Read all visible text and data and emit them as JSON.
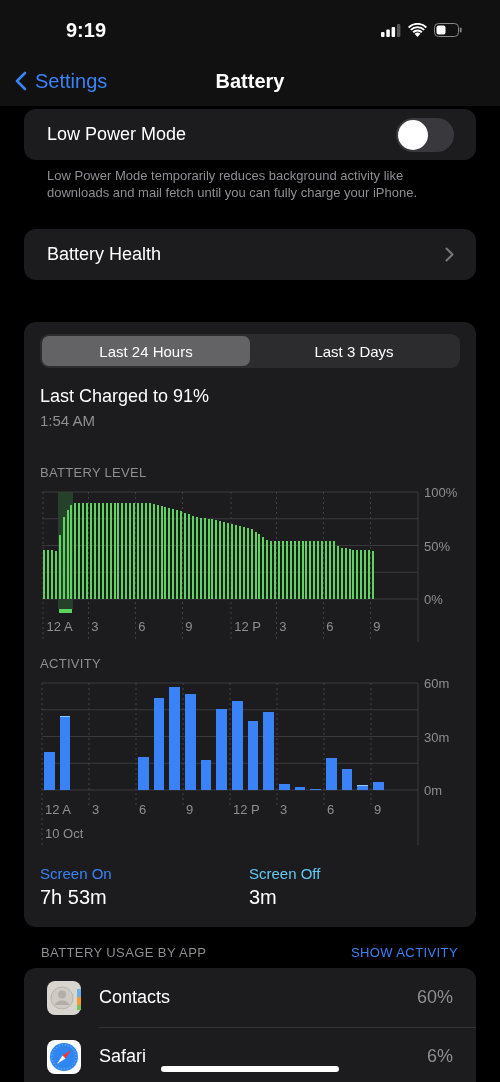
{
  "status_bar": {
    "time": "9:19"
  },
  "nav": {
    "back": "Settings",
    "title": "Battery"
  },
  "low_power": {
    "label": "Low Power Mode",
    "on": false,
    "footnote": "Low Power Mode temporarily reduces background activity like downloads and mail fetch until you can fully charge your iPhone."
  },
  "battery_health": {
    "label": "Battery Health"
  },
  "tabs": [
    {
      "label": "Last 24 Hours",
      "selected": true
    },
    {
      "label": "Last 3 Days",
      "selected": false
    }
  ],
  "last_charged": {
    "title": "Last Charged to 91%",
    "time": "1:54 AM"
  },
  "battery_level": {
    "chart_data": {
      "type": "bar",
      "title": "BATTERY LEVEL",
      "grid": true,
      "ylim": [
        0,
        100
      ],
      "categories": [
        null,
        null,
        null,
        null,
        "12 A",
        null,
        null,
        null,
        null,
        null,
        null,
        null,
        null,
        "3",
        null,
        null,
        null,
        null,
        null,
        null,
        null,
        null,
        null,
        null,
        null,
        "6",
        null,
        null,
        null,
        null,
        null,
        null,
        null,
        null,
        null,
        null,
        null,
        "9",
        null,
        null,
        null,
        null,
        null,
        null,
        null,
        null,
        null,
        null,
        null,
        null,
        null,
        null,
        "12 P",
        null,
        null,
        null,
        null,
        null,
        null,
        null,
        null,
        "3",
        null,
        null,
        null,
        null,
        null,
        null,
        null,
        null,
        null,
        null,
        null,
        "6",
        null,
        null,
        null,
        null,
        null,
        null,
        null,
        null,
        null,
        null,
        null,
        "9",
        null,
        null,
        null,
        null,
        null,
        null,
        null,
        null,
        null,
        null
      ],
      "values": [
        46,
        46,
        46,
        45,
        60,
        77,
        83,
        88,
        90,
        90,
        90,
        90,
        90,
        90,
        90,
        90,
        90,
        90,
        90,
        90,
        90,
        90,
        90,
        90,
        90,
        90,
        90,
        90,
        89,
        88,
        87,
        86,
        85,
        84,
        83,
        82,
        80,
        79,
        78,
        77,
        76,
        76,
        75,
        75,
        74,
        73,
        72,
        71,
        70,
        69,
        68,
        67,
        66,
        65,
        63,
        61,
        58,
        55,
        54,
        54,
        54,
        54,
        54,
        54,
        54,
        54,
        54,
        54,
        54,
        54,
        54,
        54,
        54,
        54,
        54,
        50,
        48,
        48,
        47,
        46,
        46,
        46,
        46,
        46,
        45,
        null,
        null,
        null,
        null,
        null,
        null,
        null,
        null,
        null,
        null,
        null
      ],
      "yticks": [
        {
          "value": 0,
          "label": "0%"
        },
        {
          "value": 50,
          "label": "50%"
        },
        {
          "value": 100,
          "label": "100%"
        }
      ]
    }
  },
  "activity": {
    "date": "10 Oct",
    "chart_data": {
      "type": "bar",
      "title": "ACTIVITY",
      "grid": true,
      "stacked": true,
      "ylim": [
        0,
        60
      ],
      "categories": [
        "12 A",
        null,
        null,
        "3",
        null,
        null,
        "6",
        null,
        null,
        "9",
        null,
        null,
        "12 P",
        null,
        null,
        "3",
        null,
        null,
        "6",
        null,
        null,
        "9",
        null,
        null
      ],
      "series": [
        {
          "color": "#3a82f7",
          "values": [
            21.5,
            41,
            null,
            null,
            null,
            null,
            18.7,
            51.8,
            57.7,
            53.7,
            16.6,
            45.7,
            49.9,
            38.7,
            43.6,
            3.6,
            1.9,
            0.8,
            17.9,
            11.8,
            2.3,
            4.6,
            null,
            null
          ]
        },
        {
          "color": "#8ec9f5",
          "values": [
            0,
            0.7,
            null,
            null,
            null,
            null,
            0,
            0,
            0,
            0,
            0,
            0,
            0,
            0,
            0,
            0,
            0,
            0,
            0,
            0,
            0.6,
            0,
            null,
            null
          ]
        }
      ],
      "yticks": [
        {
          "value": 0,
          "label": "0m"
        },
        {
          "value": 30,
          "label": "30m"
        },
        {
          "value": 60,
          "label": "60m"
        }
      ]
    }
  },
  "summary": [
    {
      "label": "Screen On",
      "value": "7h 53m",
      "color": "#3a82f7"
    },
    {
      "label": "Screen Off",
      "value": "3m",
      "color": "#64c8f5"
    }
  ],
  "usage": {
    "title": "BATTERY USAGE BY APP",
    "action": "SHOW ACTIVITY",
    "apps": [
      {
        "name": "Contacts",
        "share": "60%",
        "kind": "contacts"
      },
      {
        "name": "Safari",
        "share": "6%",
        "kind": "safari"
      }
    ]
  }
}
